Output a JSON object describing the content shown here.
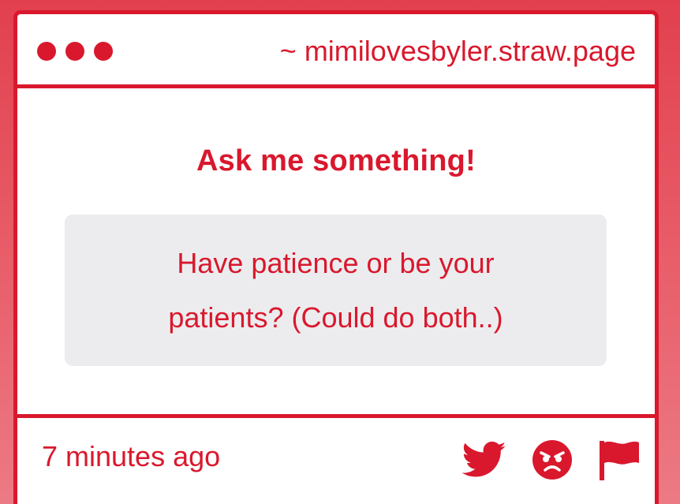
{
  "window": {
    "url": "~ mimilovesbyler.straw.page",
    "dot_color": "#d9182d"
  },
  "main": {
    "heading": "Ask me something!",
    "question_line_1": "Have patience or be your",
    "question_line_2": "patients? (Could do both..)"
  },
  "footer": {
    "timestamp": "7 minutes ago",
    "actions": [
      {
        "name": "share-twitter",
        "icon": "twitter-icon"
      },
      {
        "name": "react-angry",
        "icon": "angry-face-icon"
      },
      {
        "name": "report",
        "icon": "flag-icon"
      },
      {
        "name": "delete",
        "icon": "trash-icon"
      }
    ]
  },
  "colors": {
    "accent": "#d9182d",
    "background_top": "#e2404e",
    "background_bottom": "#ec7a84",
    "question_box": "#ececee",
    "card": "#ffffff"
  }
}
